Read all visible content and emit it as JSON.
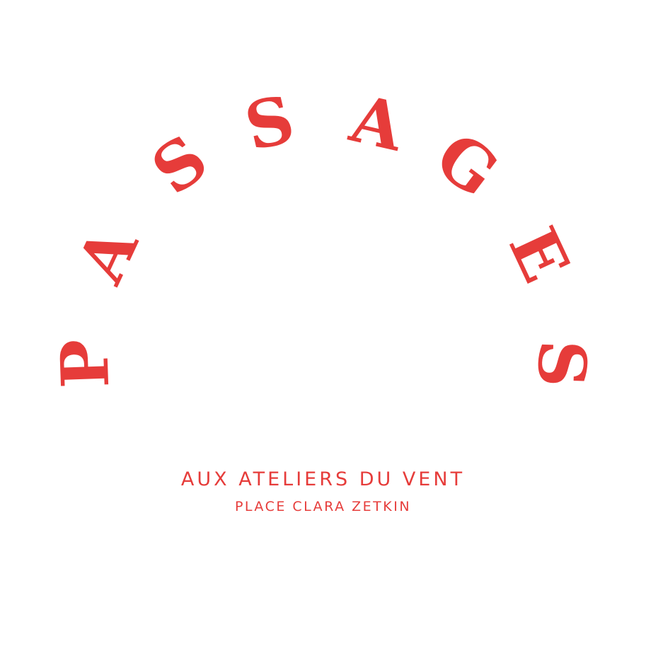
{
  "logo": {
    "letters": [
      "P",
      "A",
      "S",
      "S",
      "A",
      "G",
      "E",
      "S"
    ],
    "line1": "AUX ATELIERS DU VENT",
    "line2": "PLACE CLARA ZETKIN",
    "color": "#e63c3a"
  }
}
